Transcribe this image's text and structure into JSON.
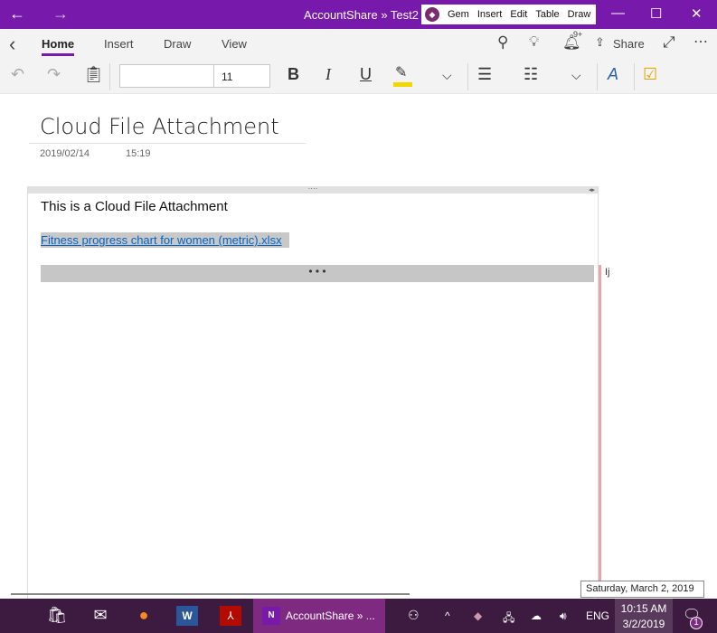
{
  "titlebar": {
    "back": "←",
    "forward": "→",
    "title": "AccountShare » Test2",
    "gem_menu": {
      "icon": "gem-icon",
      "items": [
        "Gem",
        "Insert",
        "Edit",
        "Table",
        "Draw"
      ]
    },
    "minimize": "—",
    "maximize": "☐",
    "close": "✕"
  },
  "tabs": {
    "back": "‹",
    "items": [
      "Home",
      "Insert",
      "Draw",
      "View"
    ],
    "active": "Home",
    "share": "Share",
    "notif_badge": "9+"
  },
  "toolbar": {
    "font_name": "",
    "font_size": "11",
    "bold": "B",
    "italic": "I",
    "underline": "U",
    "highlight_color": "#f2d600"
  },
  "page": {
    "title": "Cloud File Attachment",
    "date": "2019/02/14",
    "time": "15:19",
    "note_text": "This is a Cloud File Attachment",
    "file_link": "Fitness progress chart for women (metric).xlsx",
    "bar_dots": "• • •",
    "side_text": "Ij"
  },
  "tooltip": "Saturday, March 2, 2019",
  "taskbar": {
    "onenote_label": "AccountShare » ...",
    "lang": "ENG",
    "time": "10:15 AM",
    "date": "3/2/2019",
    "notif_count": "1"
  },
  "colors": {
    "accent": "#7719aa",
    "taskbar": "#3d1a40",
    "link": "#0563c1"
  }
}
